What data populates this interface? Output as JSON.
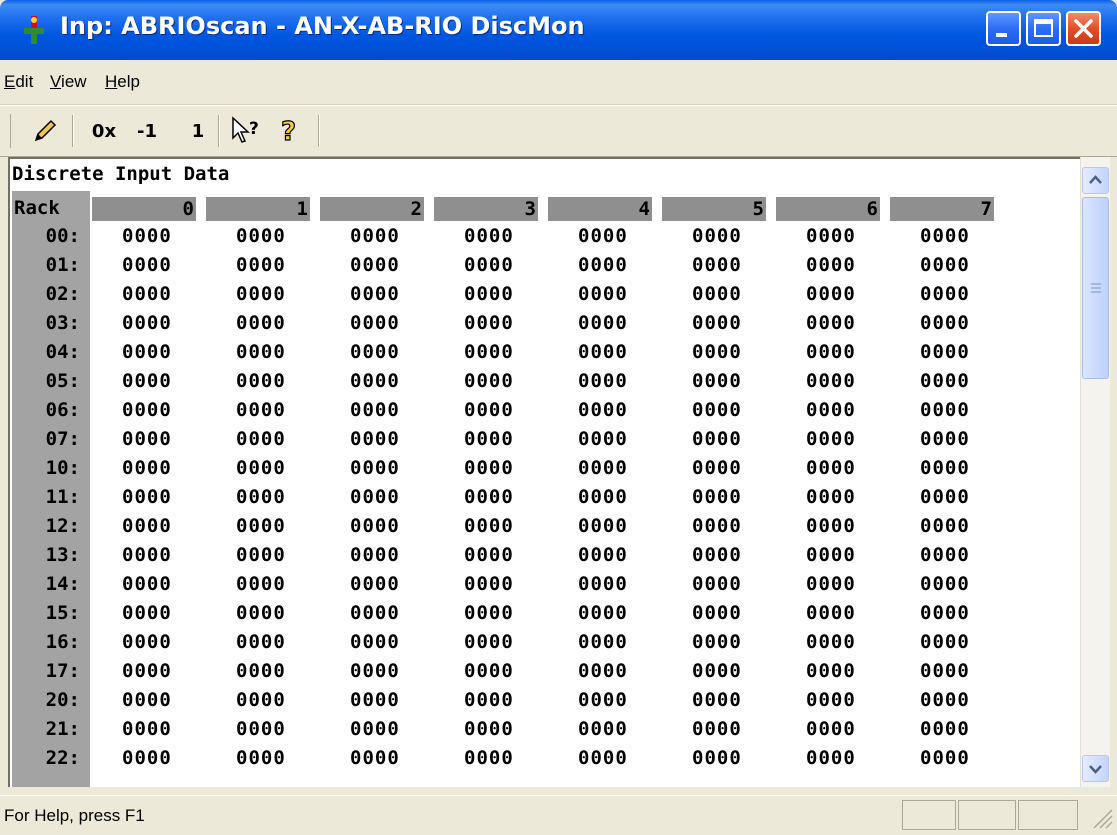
{
  "window": {
    "title": "Inp: ABRIOscan - AN-X-AB-RIO DiscMon"
  },
  "menu": [
    "Edit",
    "View",
    "Help"
  ],
  "toolbar": {
    "format_label": "0x",
    "minus_label": "-1",
    "plus_label": "1"
  },
  "data": {
    "title": "Discrete Input Data",
    "rack_header": "Rack",
    "columns": [
      "0",
      "1",
      "2",
      "3",
      "4",
      "5",
      "6",
      "7"
    ],
    "rows": [
      {
        "rack": "00:",
        "values": [
          "0000",
          "0000",
          "0000",
          "0000",
          "0000",
          "0000",
          "0000",
          "0000"
        ]
      },
      {
        "rack": "01:",
        "values": [
          "0000",
          "0000",
          "0000",
          "0000",
          "0000",
          "0000",
          "0000",
          "0000"
        ]
      },
      {
        "rack": "02:",
        "values": [
          "0000",
          "0000",
          "0000",
          "0000",
          "0000",
          "0000",
          "0000",
          "0000"
        ]
      },
      {
        "rack": "03:",
        "values": [
          "0000",
          "0000",
          "0000",
          "0000",
          "0000",
          "0000",
          "0000",
          "0000"
        ]
      },
      {
        "rack": "04:",
        "values": [
          "0000",
          "0000",
          "0000",
          "0000",
          "0000",
          "0000",
          "0000",
          "0000"
        ]
      },
      {
        "rack": "05:",
        "values": [
          "0000",
          "0000",
          "0000",
          "0000",
          "0000",
          "0000",
          "0000",
          "0000"
        ]
      },
      {
        "rack": "06:",
        "values": [
          "0000",
          "0000",
          "0000",
          "0000",
          "0000",
          "0000",
          "0000",
          "0000"
        ]
      },
      {
        "rack": "07:",
        "values": [
          "0000",
          "0000",
          "0000",
          "0000",
          "0000",
          "0000",
          "0000",
          "0000"
        ]
      },
      {
        "rack": "10:",
        "values": [
          "0000",
          "0000",
          "0000",
          "0000",
          "0000",
          "0000",
          "0000",
          "0000"
        ]
      },
      {
        "rack": "11:",
        "values": [
          "0000",
          "0000",
          "0000",
          "0000",
          "0000",
          "0000",
          "0000",
          "0000"
        ]
      },
      {
        "rack": "12:",
        "values": [
          "0000",
          "0000",
          "0000",
          "0000",
          "0000",
          "0000",
          "0000",
          "0000"
        ]
      },
      {
        "rack": "13:",
        "values": [
          "0000",
          "0000",
          "0000",
          "0000",
          "0000",
          "0000",
          "0000",
          "0000"
        ]
      },
      {
        "rack": "14:",
        "values": [
          "0000",
          "0000",
          "0000",
          "0000",
          "0000",
          "0000",
          "0000",
          "0000"
        ]
      },
      {
        "rack": "15:",
        "values": [
          "0000",
          "0000",
          "0000",
          "0000",
          "0000",
          "0000",
          "0000",
          "0000"
        ]
      },
      {
        "rack": "16:",
        "values": [
          "0000",
          "0000",
          "0000",
          "0000",
          "0000",
          "0000",
          "0000",
          "0000"
        ]
      },
      {
        "rack": "17:",
        "values": [
          "0000",
          "0000",
          "0000",
          "0000",
          "0000",
          "0000",
          "0000",
          "0000"
        ]
      },
      {
        "rack": "20:",
        "values": [
          "0000",
          "0000",
          "0000",
          "0000",
          "0000",
          "0000",
          "0000",
          "0000"
        ]
      },
      {
        "rack": "21:",
        "values": [
          "0000",
          "0000",
          "0000",
          "0000",
          "0000",
          "0000",
          "0000",
          "0000"
        ]
      },
      {
        "rack": "22:",
        "values": [
          "0000",
          "0000",
          "0000",
          "0000",
          "0000",
          "0000",
          "0000",
          "0000"
        ]
      }
    ]
  },
  "status": {
    "text": "For Help, press F1"
  },
  "icons": {
    "app": "network-plug-icon",
    "edit": "pencil-icon",
    "context_help": "whats-this-help-icon",
    "help": "help-question-icon"
  }
}
